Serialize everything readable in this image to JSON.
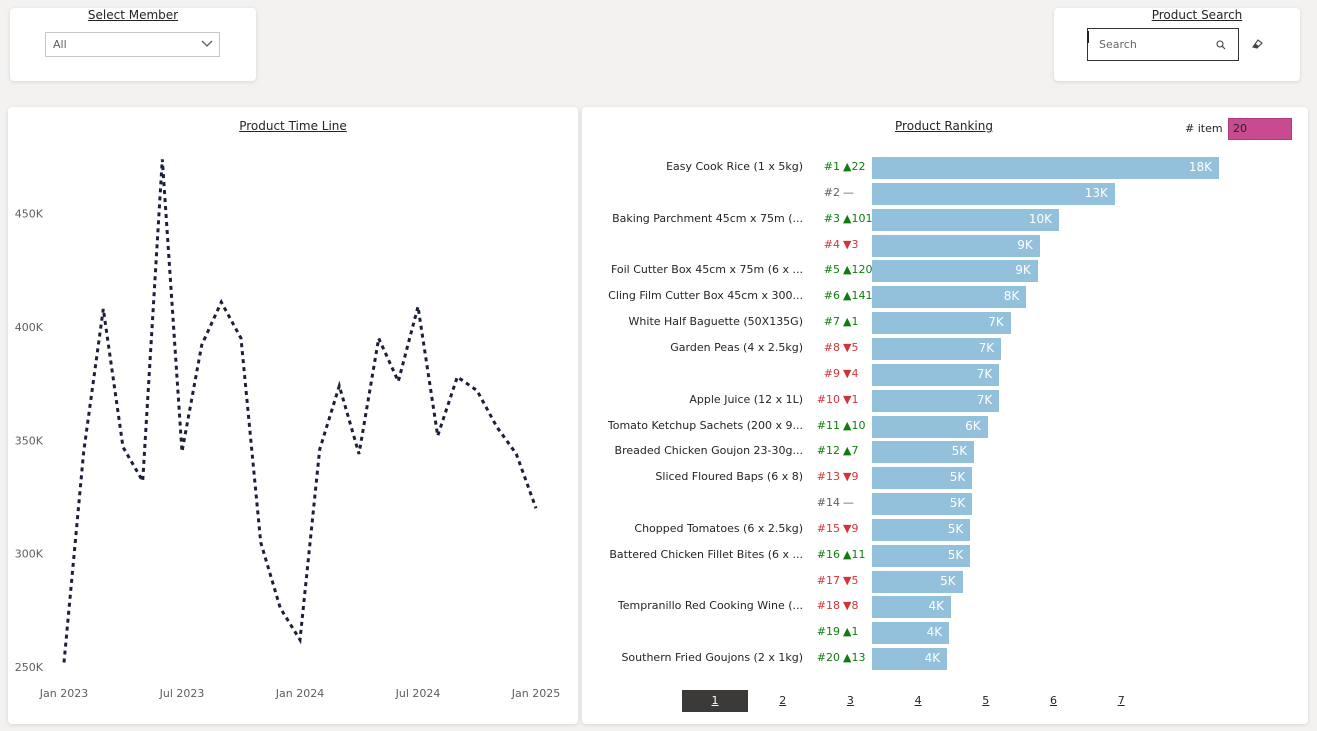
{
  "member_filter": {
    "title": "Select Member",
    "value": "All"
  },
  "product_search": {
    "title": "Product Search",
    "placeholder": "Search"
  },
  "timeline": {
    "title": "Product Time Line",
    "chart_data": {
      "type": "line",
      "style": "dotted",
      "color": "#1b1f3b",
      "x_ticks": [
        "Jan 2023",
        "Jul 2023",
        "Jan 2024",
        "Jul 2024",
        "Jan 2025"
      ],
      "y_ticks": [
        "250K",
        "300K",
        "350K",
        "400K",
        "450K"
      ],
      "ylim": [
        250000,
        475000
      ],
      "series": [
        {
          "values": [
            [
              "2023-01",
              252000
            ],
            [
              "2023-02",
              345000
            ],
            [
              "2023-03",
              408000
            ],
            [
              "2023-04",
              347000
            ],
            [
              "2023-05",
              332000
            ],
            [
              "2023-06",
              474000
            ],
            [
              "2023-07",
              345000
            ],
            [
              "2023-08",
              392000
            ],
            [
              "2023-09",
              411000
            ],
            [
              "2023-10",
              395000
            ],
            [
              "2023-11",
              305000
            ],
            [
              "2023-12",
              276000
            ],
            [
              "2024-01",
              262000
            ],
            [
              "2024-02",
              346000
            ],
            [
              "2024-03",
              374000
            ],
            [
              "2024-04",
              344000
            ],
            [
              "2024-05",
              395000
            ],
            [
              "2024-06",
              376000
            ],
            [
              "2024-07",
              409000
            ],
            [
              "2024-08",
              352000
            ],
            [
              "2024-09",
              378000
            ],
            [
              "2024-10",
              372000
            ],
            [
              "2024-11",
              356000
            ],
            [
              "2024-12",
              344000
            ],
            [
              "2025-01",
              320000
            ]
          ]
        }
      ]
    }
  },
  "ranking": {
    "title": "Product Ranking",
    "item_label": "# item",
    "item_value": "20",
    "bar_color": "#93c0da",
    "chart_data": {
      "type": "bar",
      "orientation": "horizontal",
      "xlim": [
        0,
        18000
      ],
      "rows": [
        {
          "name": "Easy Cook Rice (1 x 5kg)",
          "rank": "#1",
          "dir": "up",
          "change": "22",
          "value": 18000,
          "label": "18K"
        },
        {
          "name": "",
          "rank": "#2",
          "dir": "flat",
          "change": "",
          "value": 12600,
          "label": "13K"
        },
        {
          "name": "Baking Parchment 45cm x 75m (...",
          "rank": "#3",
          "dir": "up",
          "change": "101",
          "value": 9700,
          "label": "10K"
        },
        {
          "name": "",
          "rank": "#4",
          "dir": "down",
          "change": "3",
          "value": 8700,
          "label": "9K"
        },
        {
          "name": "Foil Cutter Box 45cm x 75m (6 x ...",
          "rank": "#5",
          "dir": "up",
          "change": "120",
          "value": 8600,
          "label": "9K"
        },
        {
          "name": "Cling Film Cutter Box 45cm x 300...",
          "rank": "#6",
          "dir": "up",
          "change": "141",
          "value": 8000,
          "label": "8K"
        },
        {
          "name": "White Half Baguette (50X135G)",
          "rank": "#7",
          "dir": "up",
          "change": "1",
          "value": 7200,
          "label": "7K"
        },
        {
          "name": "Garden Peas (4 x 2.5kg)",
          "rank": "#8",
          "dir": "down",
          "change": "5",
          "value": 6700,
          "label": "7K"
        },
        {
          "name": "",
          "rank": "#9",
          "dir": "down",
          "change": "4",
          "value": 6600,
          "label": "7K"
        },
        {
          "name": "Apple Juice (12 x 1L)",
          "rank": "#10",
          "dir": "down",
          "change": "1",
          "value": 6600,
          "label": "7K"
        },
        {
          "name": "Tomato Ketchup Sachets (200 x 9...",
          "rank": "#11",
          "dir": "up",
          "change": "10",
          "value": 6000,
          "label": "6K"
        },
        {
          "name": "Breaded Chicken Goujon 23-30g...",
          "rank": "#12",
          "dir": "up",
          "change": "7",
          "value": 5300,
          "label": "5K"
        },
        {
          "name": "Sliced Floured Baps (6 x 8)",
          "rank": "#13",
          "dir": "down",
          "change": "9",
          "value": 5200,
          "label": "5K"
        },
        {
          "name": "",
          "rank": "#14",
          "dir": "flat",
          "change": "",
          "value": 5200,
          "label": "5K"
        },
        {
          "name": "Chopped Tomatoes (6 x 2.5kg)",
          "rank": "#15",
          "dir": "down",
          "change": "9",
          "value": 5100,
          "label": "5K"
        },
        {
          "name": "Battered Chicken Fillet Bites (6 x ...",
          "rank": "#16",
          "dir": "up",
          "change": "11",
          "value": 5100,
          "label": "5K"
        },
        {
          "name": "",
          "rank": "#17",
          "dir": "down",
          "change": "5",
          "value": 4700,
          "label": "5K"
        },
        {
          "name": "Tempranillo Red Cooking Wine (...",
          "rank": "#18",
          "dir": "down",
          "change": "8",
          "value": 4100,
          "label": "4K"
        },
        {
          "name": "",
          "rank": "#19",
          "dir": "up",
          "change": "1",
          "value": 4000,
          "label": "4K"
        },
        {
          "name": "Southern Fried Goujons (2 x 1kg)",
          "rank": "#20",
          "dir": "up",
          "change": "13",
          "value": 3900,
          "label": "4K"
        }
      ]
    },
    "pages": [
      "1",
      "2",
      "3",
      "4",
      "5",
      "6",
      "7"
    ],
    "active_page": "1"
  },
  "icons": {
    "dropdown": "chevron-down-icon",
    "search": "search-icon",
    "clear": "eraser-icon"
  }
}
